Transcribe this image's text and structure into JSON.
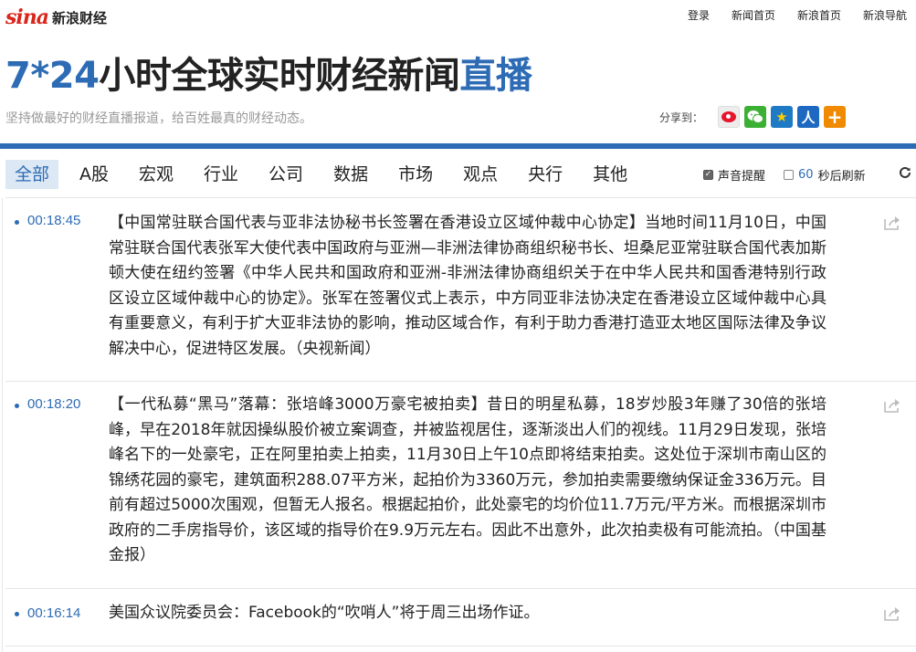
{
  "header": {
    "logo_text": "sina",
    "brand": "新浪财经",
    "nav": [
      "登录",
      "新闻首页",
      "新浪首页",
      "新浪导航"
    ]
  },
  "hero": {
    "title_prefix": "7*24",
    "title_main": "小时全球实时财经新闻",
    "title_suffix": "直播",
    "subtitle": "坚持做最好的财经直播报道，给百姓最真的财经动态。"
  },
  "share": {
    "label": "分享到：",
    "icons": [
      "weibo-icon",
      "wechat-icon",
      "qzone-icon",
      "renren-icon",
      "more-icon"
    ]
  },
  "tabs": [
    "全部",
    "A股",
    "宏观",
    "行业",
    "公司",
    "数据",
    "市场",
    "观点",
    "央行",
    "其他"
  ],
  "active_tab": "全部",
  "options": {
    "sound_label": "声音提醒",
    "sound_checked": true,
    "refresh_seconds": "60",
    "refresh_label": "秒后刷新",
    "refresh_checked": false
  },
  "news": [
    {
      "time": "00:18:45",
      "text": "【中国常驻联合国代表与亚非法协秘书长签署在香港设立区域仲裁中心协定】当地时间11月10日，中国常驻联合国代表张军大使代表中国政府与亚洲—非洲法律协商组织秘书长、坦桑尼亚常驻联合国代表加斯顿大使在纽约签署《中华人民共和国政府和亚洲-非洲法律协商组织关于在中华人民共和国香港特别行政区设立区域仲裁中心的协定》。张军在签署仪式上表示，中方同亚非法协决定在香港设立区域仲裁中心具有重要意义，有利于扩大亚非法协的影响，推动区域合作，有利于助力香港打造亚太地区国际法律及争议解决中心，促进特区发展。（央视新闻）"
    },
    {
      "time": "00:18:20",
      "text": "【一代私募“黑马”落幕：张培峰3000万豪宅被拍卖】昔日的明星私募，18岁炒股3年赚了30倍的张培峰，早在2018年就因操纵股价被立案调查，并被监视居住，逐渐淡出人们的视线。11月29日发现，张培峰名下的一处豪宅，正在阿里拍卖上拍卖，11月30日上午10点即将结束拍卖。这处位于深圳市南山区的锦绣花园的豪宅，建筑面积288.07平方米，起拍价为3360万元，参加拍卖需要缴纳保证金336万元。目前有超过5000次围观，但暂无人报名。根据起拍价，此处豪宅的均价位11.7万元/平方米。而根据深圳市政府的二手房指导价，该区域的指导价在9.9万元左右。因此不出意外，此次拍卖极有可能流拍。（中国基金报）"
    },
    {
      "time": "00:16:14",
      "text": "美国众议院委员会：Facebook的“吹哨人”将于周三出场作证。"
    }
  ]
}
